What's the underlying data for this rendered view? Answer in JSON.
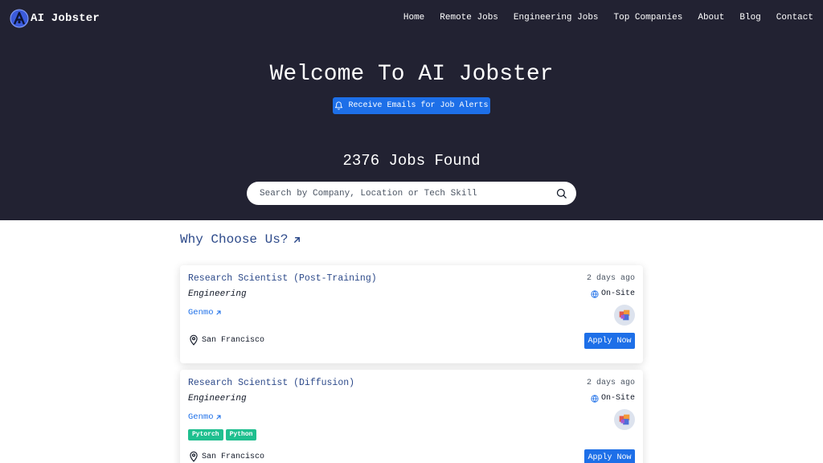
{
  "brand": {
    "name": "AI Jobster",
    "logo_icon": "ai-jobster-logo"
  },
  "nav": {
    "items": [
      {
        "label": "Home"
      },
      {
        "label": "Remote Jobs"
      },
      {
        "label": "Engineering Jobs"
      },
      {
        "label": "Top Companies"
      },
      {
        "label": "About"
      },
      {
        "label": "Blog"
      },
      {
        "label": "Contact"
      }
    ]
  },
  "hero": {
    "title": "Welcome To AI Jobster",
    "alert_button": "Receive Emails for Job Alerts",
    "alert_icon": "bell-icon",
    "jobs_found": "2376 Jobs Found"
  },
  "search": {
    "placeholder": "Search by Company, Location or Tech Skill",
    "value": "",
    "icon": "search-icon"
  },
  "why_link": {
    "label": "Why Choose Us?",
    "icon": "external-arrow-icon"
  },
  "colors": {
    "hero_bg": "#222232",
    "accent": "#1d6fe8",
    "title_blue": "#2d4a8a",
    "tag_green": "#1fbf8f"
  },
  "jobs": [
    {
      "title": "Research Scientist (Post-Training)",
      "posted": "2 days ago",
      "category": "Engineering",
      "work_type": "On-Site",
      "company": "Genmo",
      "tags": [],
      "location": "San Francisco",
      "apply_label": "Apply Now"
    },
    {
      "title": "Research Scientist (Diffusion)",
      "posted": "2 days ago",
      "category": "Engineering",
      "work_type": "On-Site",
      "company": "Genmo",
      "tags": [
        "Pytorch",
        "Python"
      ],
      "location": "San Francisco",
      "apply_label": "Apply Now"
    }
  ]
}
